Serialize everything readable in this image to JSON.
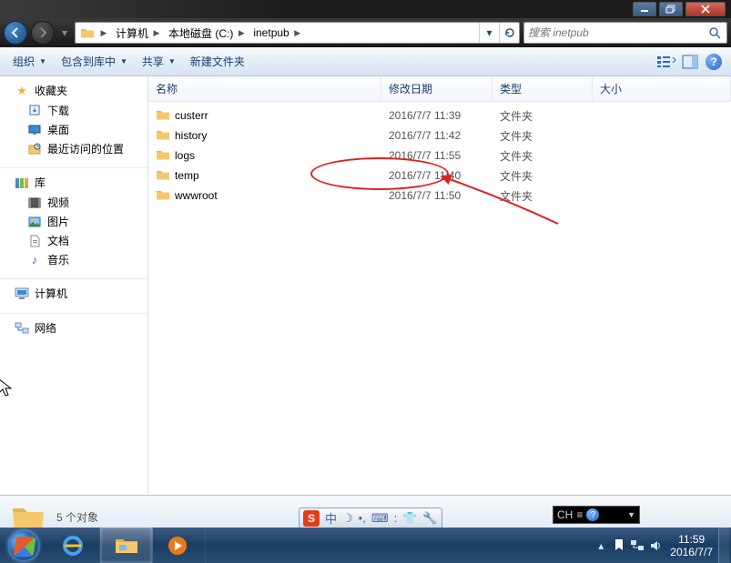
{
  "window": {
    "restore_tip": "Restore Down",
    "close_tip": "Close",
    "min_tip": "Minimize"
  },
  "nav": {
    "back_tip": "后退",
    "forward_tip": "前进"
  },
  "breadcrumb": [
    "计算机",
    "本地磁盘 (C:)",
    "inetpub"
  ],
  "search": {
    "placeholder": "搜索 inetpub"
  },
  "toolbar": {
    "organize": "组织",
    "include": "包含到库中",
    "share": "共享",
    "newfolder": "新建文件夹",
    "view_tip": "更改视图",
    "preview_tip": "显示预览窗格",
    "help_tip": "获取帮助"
  },
  "columns": {
    "name": "名称",
    "date": "修改日期",
    "type": "类型",
    "size": "大小"
  },
  "sidebar": {
    "favorites": {
      "label": "收藏夹",
      "items": [
        "下载",
        "桌面",
        "最近访问的位置"
      ]
    },
    "libraries": {
      "label": "库",
      "items": [
        "视频",
        "图片",
        "文档",
        "音乐"
      ]
    },
    "computer": {
      "label": "计算机"
    },
    "network": {
      "label": "网络"
    }
  },
  "files": [
    {
      "name": "custerr",
      "date": "2016/7/7 11:39",
      "type": "文件夹",
      "size": ""
    },
    {
      "name": "history",
      "date": "2016/7/7 11:42",
      "type": "文件夹",
      "size": ""
    },
    {
      "name": "logs",
      "date": "2016/7/7 11:55",
      "type": "文件夹",
      "size": ""
    },
    {
      "name": "temp",
      "date": "2016/7/7 11:40",
      "type": "文件夹",
      "size": ""
    },
    {
      "name": "wwwroot",
      "date": "2016/7/7 11:50",
      "type": "文件夹",
      "size": ""
    }
  ],
  "status": {
    "text": "5 个对象"
  },
  "ime": {
    "logo": "S",
    "char": "中",
    "moon": "☽",
    "dots": "•,",
    "kbd": "⌨",
    "sep": ":",
    "shirt": "👕",
    "wrench": "🔧"
  },
  "lang": {
    "label": "CH",
    "z": "≡"
  },
  "tray": {
    "time": "11:59",
    "date": "2016/7/7"
  },
  "taskbar": {
    "items": [
      "ie",
      "explorer",
      "wmp"
    ]
  }
}
